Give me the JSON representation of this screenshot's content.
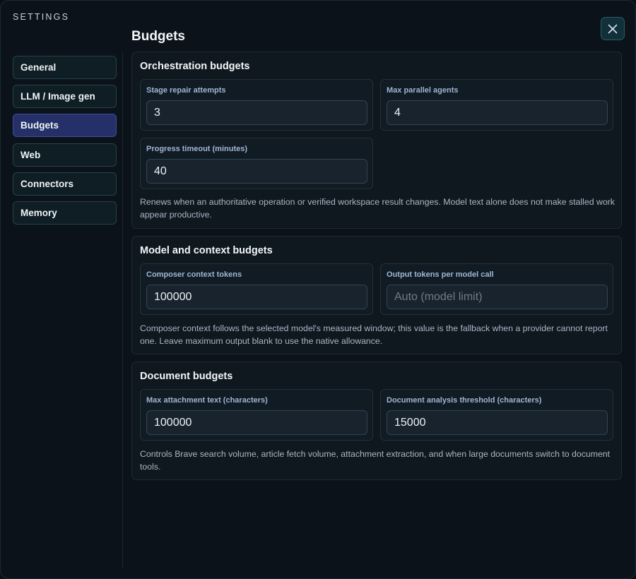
{
  "header": {
    "settings_label": "SETTINGS",
    "page_title": "Budgets",
    "close_icon": "close-icon"
  },
  "nav": {
    "items": [
      {
        "label": "General"
      },
      {
        "label": "LLM / Image gen"
      },
      {
        "label": "Budgets",
        "active": true
      },
      {
        "label": "Web"
      },
      {
        "label": "Connectors"
      },
      {
        "label": "Memory"
      }
    ]
  },
  "orchestration": {
    "title": "Orchestration budgets",
    "stage_repair": {
      "label": "Stage repair attempts",
      "value": "3"
    },
    "max_parallel": {
      "label": "Max parallel agents",
      "value": "4"
    },
    "progress_timeout": {
      "label": "Progress timeout (minutes)",
      "value": "40"
    },
    "help": "Renews when an authoritative operation or verified workspace result changes. Model text alone does not make stalled work appear productive."
  },
  "model_context": {
    "title": "Model and context budgets",
    "composer_tokens": {
      "label": "Composer context tokens",
      "value": "100000"
    },
    "output_tokens": {
      "label": "Output tokens per model call",
      "value": "",
      "placeholder": "Auto (model limit)"
    },
    "help": "Composer context follows the selected model's measured window; this value is the fallback when a provider cannot report one. Leave maximum output blank to use the native allowance."
  },
  "document": {
    "title": "Document budgets",
    "max_attachment": {
      "label": "Max attachment text (characters)",
      "value": "100000"
    },
    "analysis_threshold": {
      "label": "Document analysis threshold (characters)",
      "value": "15000"
    },
    "help": "Controls Brave search volume, article fetch volume, attachment extraction, and when large documents switch to document tools."
  },
  "colors": {
    "accent_active": "#243067",
    "panel_bg": "#0f171f",
    "close_bg": "#12303a"
  }
}
